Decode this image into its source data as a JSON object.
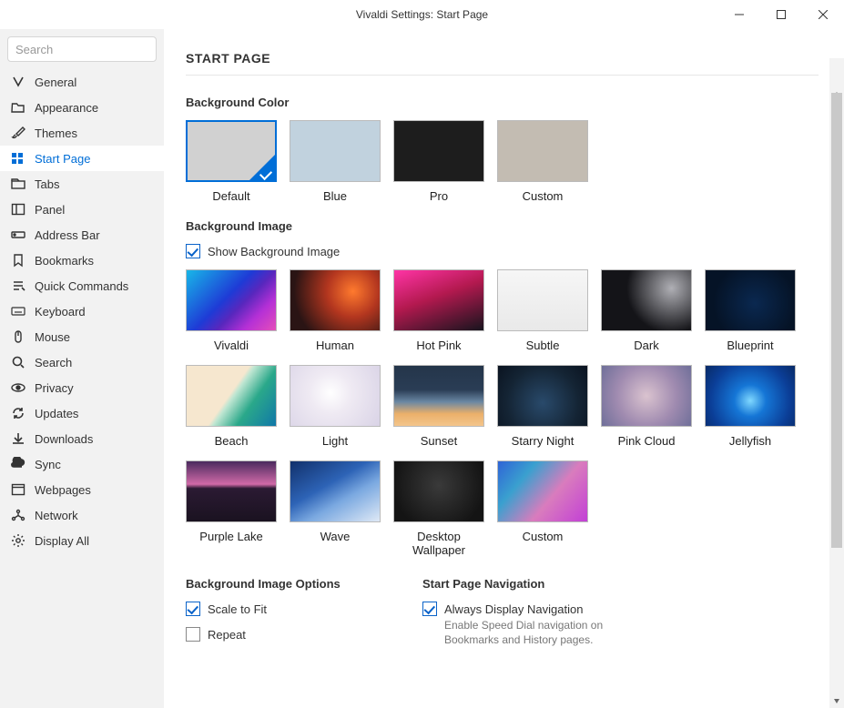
{
  "window": {
    "title": "Vivaldi Settings: Start Page"
  },
  "search": {
    "placeholder": "Search"
  },
  "sidebar": {
    "items": [
      {
        "label": "General",
        "icon": "vivaldi"
      },
      {
        "label": "Appearance",
        "icon": "folder"
      },
      {
        "label": "Themes",
        "icon": "brush"
      },
      {
        "label": "Start Page",
        "icon": "grid",
        "active": true
      },
      {
        "label": "Tabs",
        "icon": "tabs"
      },
      {
        "label": "Panel",
        "icon": "panel"
      },
      {
        "label": "Address Bar",
        "icon": "address"
      },
      {
        "label": "Bookmarks",
        "icon": "bookmark"
      },
      {
        "label": "Quick Commands",
        "icon": "quick"
      },
      {
        "label": "Keyboard",
        "icon": "keyboard"
      },
      {
        "label": "Mouse",
        "icon": "mouse"
      },
      {
        "label": "Search",
        "icon": "search"
      },
      {
        "label": "Privacy",
        "icon": "privacy"
      },
      {
        "label": "Updates",
        "icon": "updates"
      },
      {
        "label": "Downloads",
        "icon": "downloads"
      },
      {
        "label": "Sync",
        "icon": "sync"
      },
      {
        "label": "Webpages",
        "icon": "webpages"
      },
      {
        "label": "Network",
        "icon": "network"
      },
      {
        "label": "Display All",
        "icon": "gear"
      }
    ]
  },
  "page": {
    "title": "START PAGE",
    "bgcolor": {
      "heading": "Background Color",
      "options": [
        {
          "label": "Default",
          "css": "background:#d1d1d1;",
          "selected": true
        },
        {
          "label": "Blue",
          "css": "background:#c1d2de;"
        },
        {
          "label": "Pro",
          "css": "background:#1d1d1d;"
        },
        {
          "label": "Custom",
          "css": "background:#c3bcb2;"
        }
      ]
    },
    "bgimage": {
      "heading": "Background Image",
      "show_label": "Show Background Image",
      "show_checked": true,
      "options": [
        {
          "label": "Vivaldi",
          "css": "background:linear-gradient(135deg,#18b7e8 0%,#1e3bd6 45%,#5827bd 60%,#b530d6 78%,#e64fb9 100%);"
        },
        {
          "label": "Human",
          "css": "background:radial-gradient(circle at 70% 35%,#ff7a2e 0%,#b3361f 35%,#2a1414 80%);"
        },
        {
          "label": "Hot Pink",
          "css": "background:linear-gradient(160deg,#ff34a6 0%,#b3194f 45%,#17141d 100%);"
        },
        {
          "label": "Subtle",
          "css": "background:linear-gradient(180deg,#f6f6f6 0%,#e9e9e9 100%);"
        },
        {
          "label": "Dark",
          "css": "background:radial-gradient(circle at 78% 30%,rgba(110,110,120,.55) 0%,rgba(20,20,24,1) 55%);"
        },
        {
          "label": "Blueprint",
          "css": "background:radial-gradient(circle at 55% 55%,#0a2850 0%,#051326 70%);"
        },
        {
          "label": "Beach",
          "css": "background:linear-gradient(125deg,#f6e7cf 48%,#bfe6d2 52%,#2aa88a 70%,#1077a8 100%);"
        },
        {
          "label": "Light",
          "css": "background:radial-gradient(circle at 45% 45%,#ffffff 0%,#efeaf3 35%,#d9d3e6 100%);"
        },
        {
          "label": "Sunset",
          "css": "background:linear-gradient(180deg,#24354a 0%,#2a3d55 40%,#6a87a3 60%,#ebb06a 80%,#f3c58c 100%);"
        },
        {
          "label": "Starry Night",
          "css": "background:radial-gradient(circle at 50% 62%,#294a6b 0%,#142434 62%,#0a1320 100%);"
        },
        {
          "label": "Pink Cloud",
          "css": "background:radial-gradient(circle at 50% 50%,#dac3cf 0%,#a08bb0 55%,#6f6f99 100%);"
        },
        {
          "label": "Jellyfish",
          "css": "background:radial-gradient(circle at 50% 58%,#7fd8ff 0%,#1576d6 28%,#0b3e97 70%,#082a66 100%);"
        },
        {
          "label": "Purple Lake",
          "css": "background:linear-gradient(180deg,#4a2a5e 0%,#d06aa8 38%,#2b1a33 45%,#1a1220 100%);"
        },
        {
          "label": "Wave",
          "css": "background:linear-gradient(150deg,#11306b 0%,#2d63b6 40%,#7aa8e0 62%,#dfe9f6 100%);"
        },
        {
          "label": "Desktop Wallpaper",
          "css": "background:radial-gradient(circle at 50% 40%,#3a3a3a 0%,#141414 80%);"
        },
        {
          "label": "Custom",
          "css": "background:linear-gradient(130deg,#2f64d6 0%,#3aa0cf 28%,#d97cbd 60%,#c23fd6 100%);"
        }
      ]
    },
    "imgopts": {
      "heading": "Background Image Options",
      "scale_label": "Scale to Fit",
      "scale_checked": true,
      "repeat_label": "Repeat",
      "repeat_checked": false
    },
    "nav": {
      "heading": "Start Page Navigation",
      "always_label": "Always Display Navigation",
      "always_checked": true,
      "help": "Enable Speed Dial navigation on Bookmarks and History pages."
    }
  }
}
